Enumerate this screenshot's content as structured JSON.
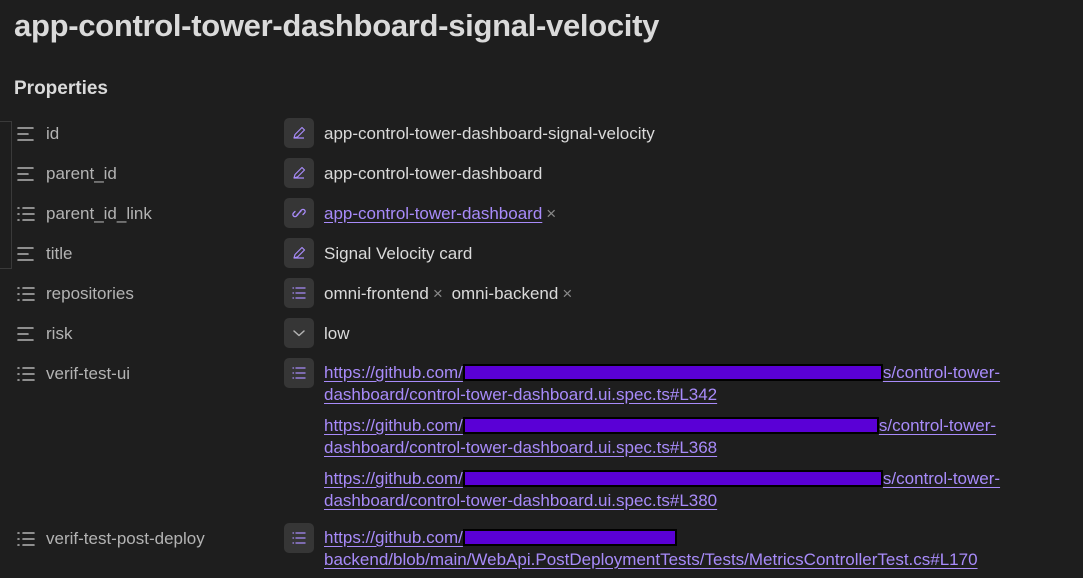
{
  "note": {
    "title": "app-control-tower-dashboard-signal-velocity"
  },
  "properties": {
    "heading": "Properties",
    "rows": [
      {
        "key": "id",
        "key_icon": "text-lines-icon",
        "type_icon": "pencil-icon",
        "value": "app-control-tower-dashboard-signal-velocity"
      },
      {
        "key": "parent_id",
        "key_icon": "text-lines-icon",
        "type_icon": "pencil-icon",
        "value": "app-control-tower-dashboard"
      },
      {
        "key": "parent_id_link",
        "key_icon": "list-icon",
        "type_icon": "link-icon",
        "value": "app-control-tower-dashboard",
        "remove": "×"
      },
      {
        "key": "title",
        "key_icon": "text-lines-icon",
        "type_icon": "pencil-icon",
        "value": "Signal Velocity card"
      },
      {
        "key": "repositories",
        "key_icon": "list-icon",
        "type_icon": "list-icon",
        "values": [
          "omni-frontend",
          "omni-backend"
        ],
        "remove": "×"
      },
      {
        "key": "risk",
        "key_icon": "text-lines-icon",
        "type_icon": "chevron-down-icon",
        "value": "low"
      },
      {
        "key": "verif-test-ui",
        "key_icon": "list-icon",
        "type_icon": "list-icon",
        "links": [
          {
            "prefix": "https://github.com/",
            "suffix": "s/control-tower-",
            "line2": "dashboard/control-tower-dashboard.ui.spec.ts#L342"
          },
          {
            "prefix": "https://github.com/",
            "suffix": "s/control-tower-",
            "line2": "dashboard/control-tower-dashboard.ui.spec.ts#L368"
          },
          {
            "prefix": "https://github.com/",
            "suffix": "s/control-tower-",
            "line2": "dashboard/control-tower-dashboard.ui.spec.ts#L380"
          }
        ]
      },
      {
        "key": "verif-test-post-deploy",
        "key_icon": "list-icon",
        "type_icon": "list-icon",
        "links": [
          {
            "prefix": "https://github.com/",
            "suffix": "",
            "line2": "backend/blob/main/WebApi.PostDeploymentTests/Tests/MetricsControllerTest.cs#L170"
          }
        ]
      }
    ]
  },
  "colors": {
    "background": "#1e1e1e",
    "text": "#dadada",
    "muted": "#b3b3b3",
    "link": "#a88bfa",
    "button_bg": "#363636",
    "redaction": "#5a00d6"
  }
}
